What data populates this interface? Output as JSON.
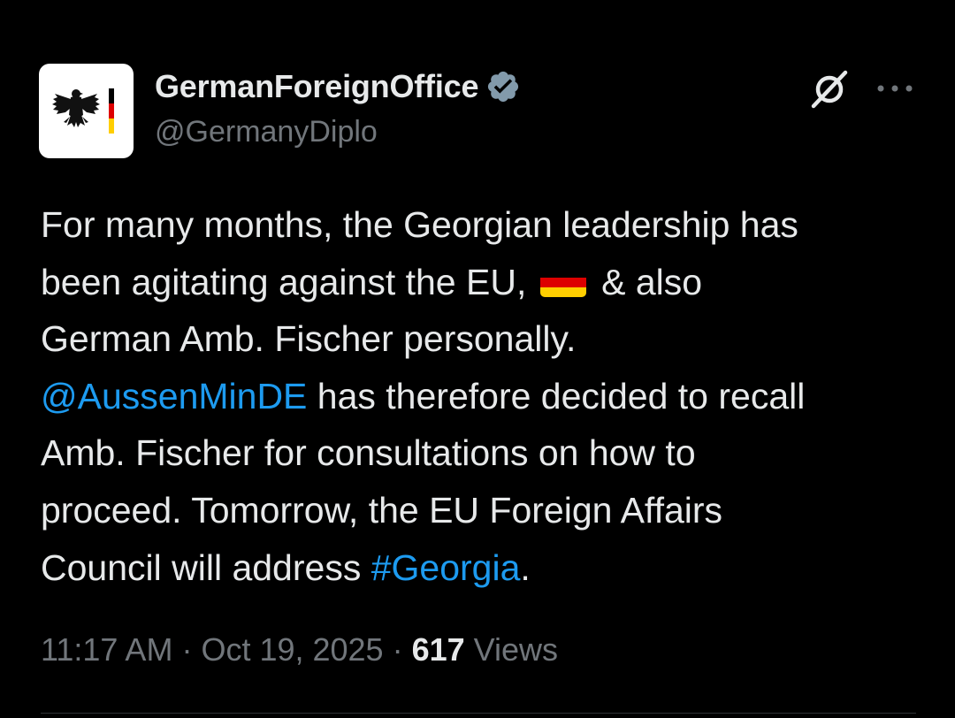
{
  "author": {
    "display_name": "GermanForeignOffice",
    "handle": "@GermanyDiplo",
    "verified_badge_color": "#829aab",
    "avatar_icon": "federal-eagle-logo"
  },
  "actions": {
    "grok_icon": "grok-icon",
    "more_icon": "more-horizontal-icon"
  },
  "tweet": {
    "line1": "For many months, the Georgian leadership has",
    "line2_before_flag": "been agitating against the EU, ",
    "flag_emoji": "german-flag",
    "line2_after_flag": " & also",
    "line3": "German Amb. Fischer personally.",
    "mention": "@AussenMinDE",
    "line4_rest": " has therefore decided to recall",
    "line5": "Amb. Fischer for consultations on how to",
    "line6": "proceed. Tomorrow, the EU Foreign Affairs",
    "line7_before_hashtag": "Council will address ",
    "hashtag": "#Georgia",
    "line7_end": "."
  },
  "meta": {
    "time": "11:17 AM",
    "separator": " · ",
    "date": "Oct 19, 2025",
    "separator2": " · ",
    "views_count": "617",
    "views_label": " Views"
  },
  "colors": {
    "background": "#000000",
    "text_primary": "#e7e9ea",
    "text_secondary": "#71767b",
    "link": "#1d9bf0",
    "divider": "#2f3336"
  }
}
